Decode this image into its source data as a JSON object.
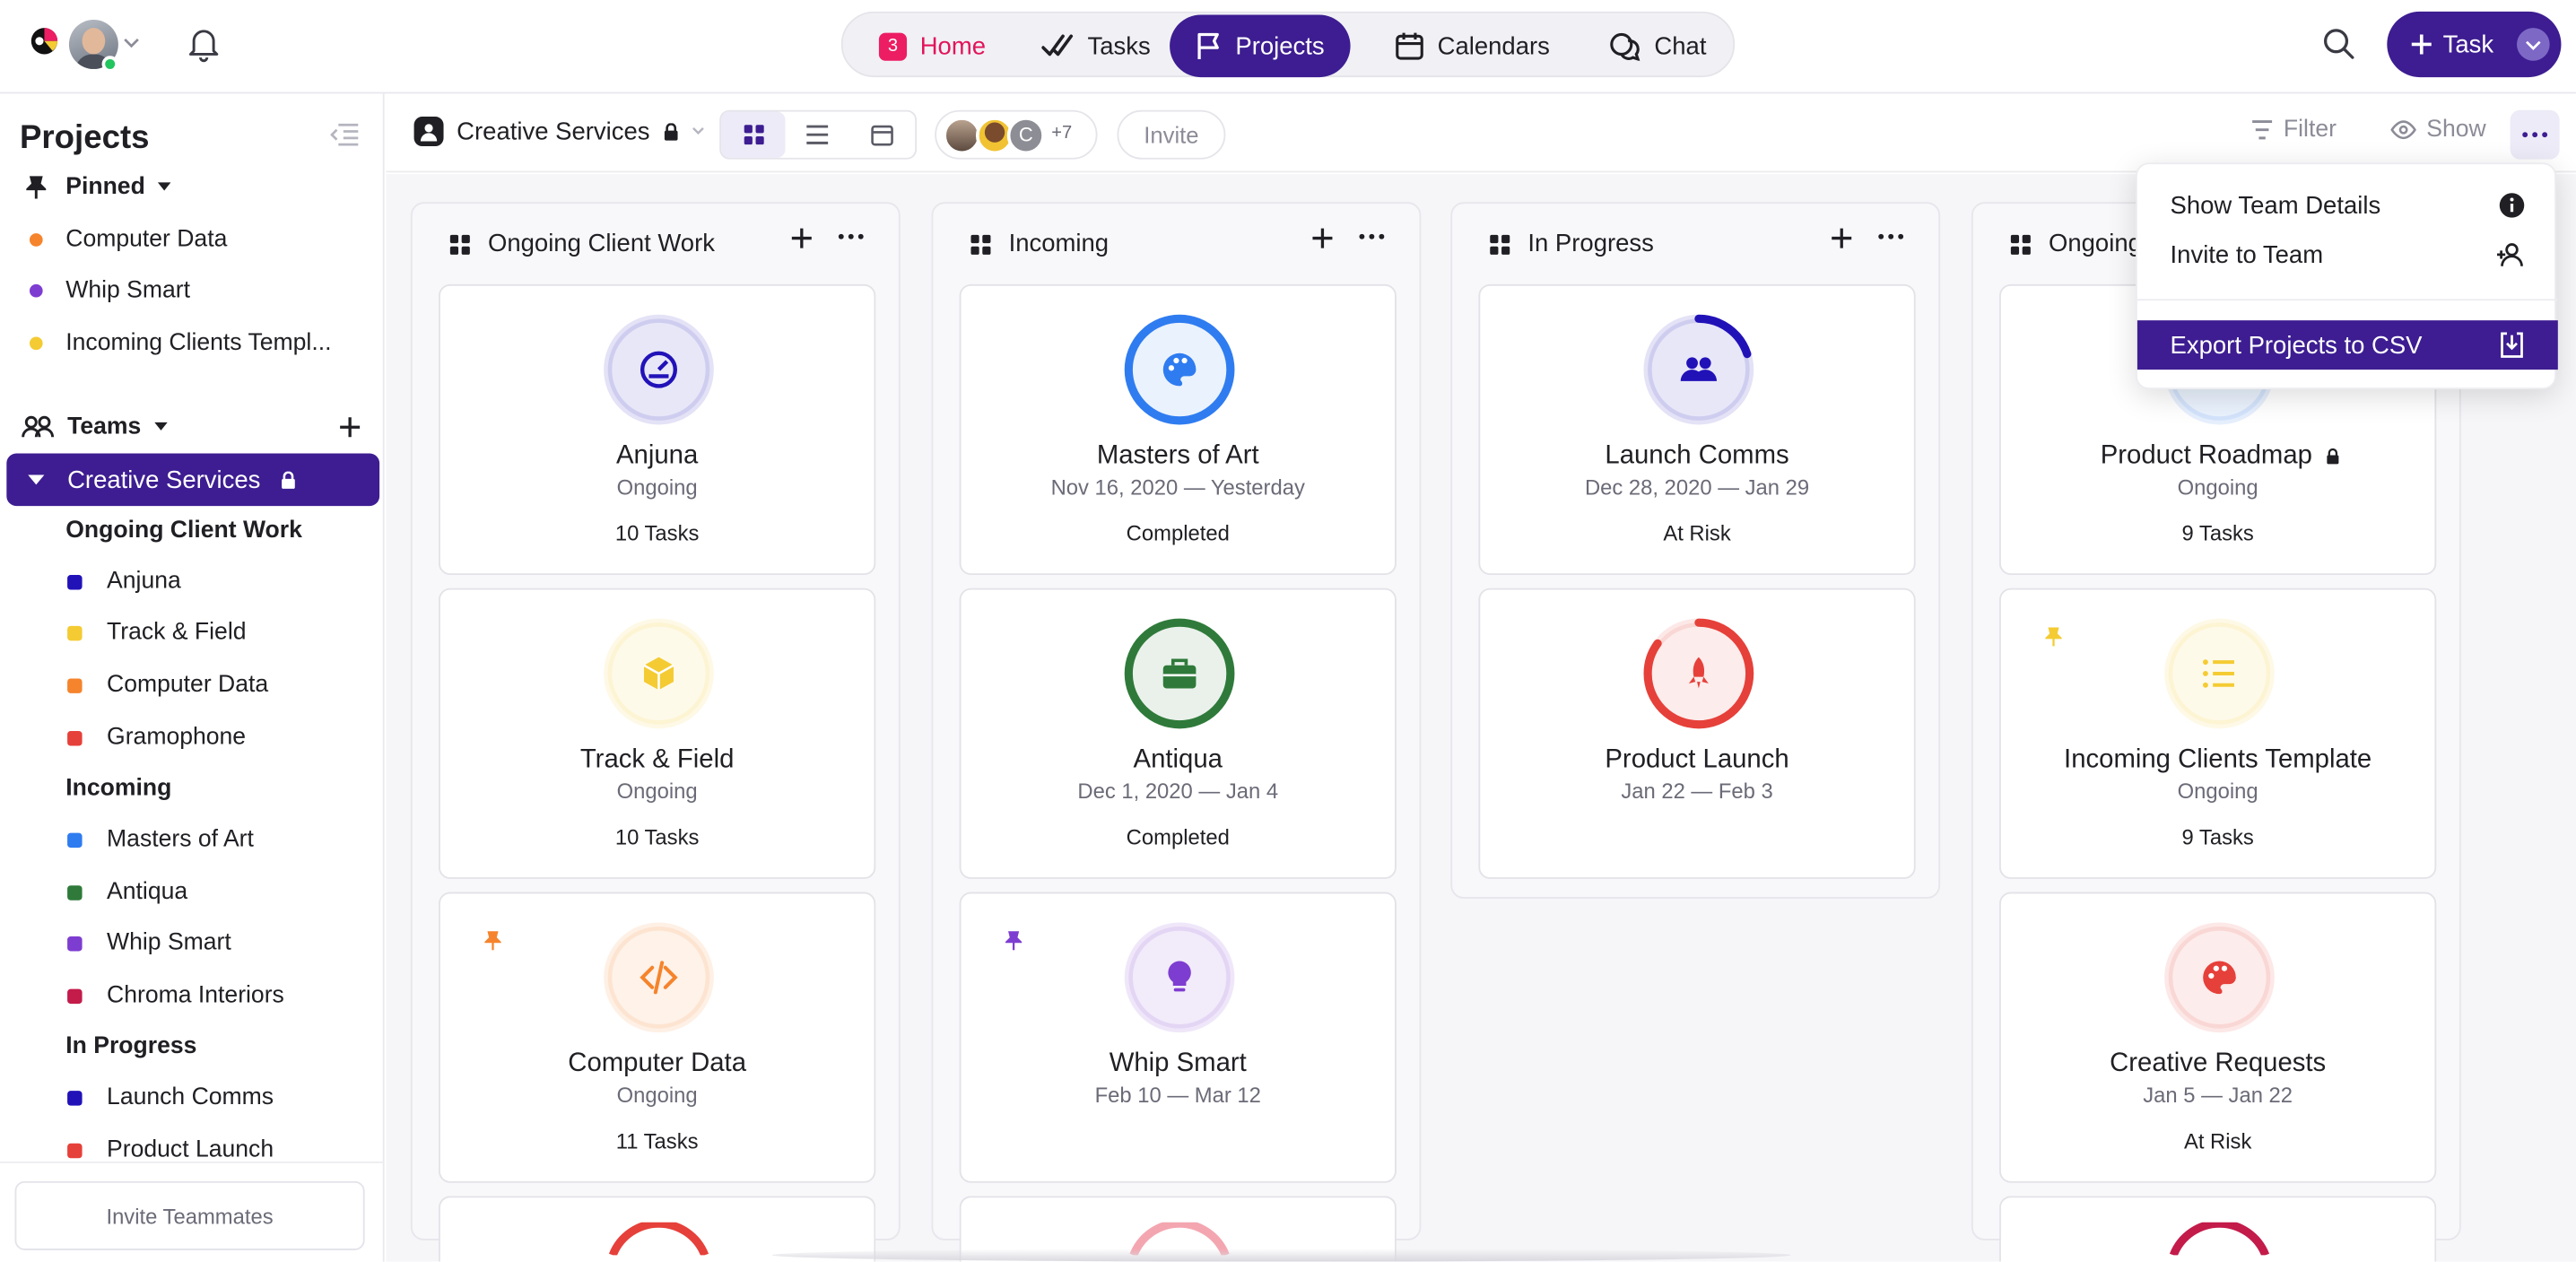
{
  "topbar": {
    "nav": [
      {
        "label": "Home",
        "badge": "3",
        "icon": "home-icon"
      },
      {
        "label": "Tasks",
        "icon": "tasks-check-icon"
      },
      {
        "label": "Projects",
        "icon": "flag-icon"
      },
      {
        "label": "Calendars",
        "icon": "calendar-icon"
      },
      {
        "label": "Chat",
        "icon": "chat-icon"
      }
    ],
    "task_button": "Task"
  },
  "sidebar": {
    "title": "Projects",
    "pinned_label": "Pinned",
    "pinned": [
      {
        "label": "Computer Data",
        "color": "#f5842c"
      },
      {
        "label": "Whip Smart",
        "color": "#7e3dd1"
      },
      {
        "label": "Incoming Clients Templ...",
        "color": "#f4cb33"
      }
    ],
    "teams_label": "Teams",
    "selected_team": "Creative Services",
    "groups": [
      {
        "label": "Ongoing Client Work",
        "items": [
          {
            "label": "Anjuna",
            "color": "#2112b8"
          },
          {
            "label": "Track & Field",
            "color": "#f4cb33"
          },
          {
            "label": "Computer Data",
            "color": "#f5842c"
          },
          {
            "label": "Gramophone",
            "color": "#e6403a"
          }
        ]
      },
      {
        "label": "Incoming",
        "items": [
          {
            "label": "Masters of Art",
            "color": "#2f7cf0"
          },
          {
            "label": "Antiqua",
            "color": "#2f7a3a"
          },
          {
            "label": "Whip Smart",
            "color": "#7e3dd1"
          },
          {
            "label": "Chroma Interiors",
            "color": "#c31b4a"
          }
        ]
      },
      {
        "label": "In Progress",
        "items": [
          {
            "label": "Launch Comms",
            "color": "#2112b8"
          },
          {
            "label": "Product Launch",
            "color": "#e6403a"
          }
        ]
      }
    ],
    "invite_teammates": "Invite Teammates"
  },
  "toolbar": {
    "team_name": "Creative Services",
    "member_initial": "C",
    "member_more": "+7",
    "invite": "Invite",
    "filter": "Filter",
    "show": "Show"
  },
  "columns": [
    {
      "title": "Ongoing Client Work",
      "cards": [
        {
          "name": "Anjuna",
          "sub": "Ongoing",
          "meta": "10 Tasks",
          "color": "#2112b8",
          "icon": "dashboard-gauge-icon",
          "progress": 0,
          "pinned": false
        },
        {
          "name": "Track & Field",
          "sub": "Ongoing",
          "meta": "10 Tasks",
          "color": "#f4cb33",
          "icon": "box-icon",
          "progress": 0,
          "pinned": false
        },
        {
          "name": "Computer Data",
          "sub": "Ongoing",
          "meta": "11 Tasks",
          "color": "#f5842c",
          "icon": "code-icon",
          "progress": 0,
          "pinned": true
        }
      ]
    },
    {
      "title": "Incoming",
      "cards": [
        {
          "name": "Masters of Art",
          "sub": "Nov 16, 2020 — Yesterday",
          "meta": "Completed",
          "color": "#2f7cf0",
          "icon": "palette-icon",
          "progress": 1,
          "pinned": false
        },
        {
          "name": "Antiqua",
          "sub": "Dec 1, 2020 — Jan 4",
          "meta": "Completed",
          "color": "#2f7a3a",
          "icon": "briefcase-icon",
          "progress": 1,
          "pinned": false
        },
        {
          "name": "Whip Smart",
          "sub": "Feb 10 — Mar 12",
          "meta": "",
          "color": "#7e3dd1",
          "icon": "lightbulb-icon",
          "progress": 0,
          "pinned": true
        }
      ]
    },
    {
      "title": "In Progress",
      "cards": [
        {
          "name": "Launch Comms",
          "sub": "Dec 28, 2020 — Jan 29",
          "meta": "At Risk",
          "color": "#2112b8",
          "icon": "people-icon",
          "progress": 0.2,
          "pinned": false
        },
        {
          "name": "Product Launch",
          "sub": "Jan 22 — Feb 3",
          "meta": "",
          "color": "#e6403a",
          "icon": "rocket-icon",
          "progress": 0.85,
          "pinned": false
        }
      ]
    },
    {
      "title": "Ongoing",
      "cards": [
        {
          "name": "Product Roadmap",
          "sub": "Ongoing",
          "meta": "9 Tasks",
          "color": "#2f7cf0",
          "icon": "roadmap-icon",
          "progress": 0,
          "pinned": false
        },
        {
          "name": "Incoming Clients Template",
          "sub": "Ongoing",
          "meta": "9 Tasks",
          "color": "#f4cb33",
          "icon": "list-icon",
          "progress": 0,
          "pinned": true
        },
        {
          "name": "Creative Requests",
          "sub": "Jan 5 — Jan 22",
          "meta": "At Risk",
          "color": "#e6403a",
          "icon": "palette-icon",
          "progress": 0,
          "pinned": false
        }
      ]
    }
  ],
  "dropdown": {
    "items": [
      {
        "label": "Show Team Details",
        "icon": "info-icon"
      },
      {
        "label": "Invite to Team",
        "icon": "add-person-icon"
      },
      {
        "label": "Export Projects to CSV",
        "icon": "download-icon"
      }
    ]
  }
}
